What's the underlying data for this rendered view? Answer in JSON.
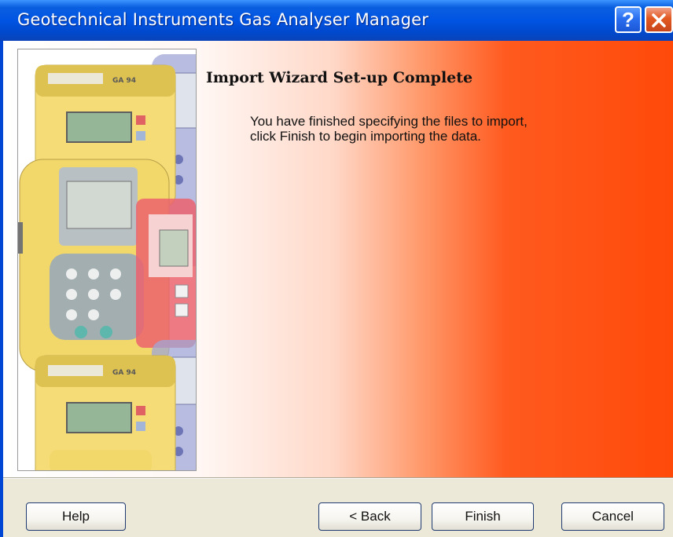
{
  "window": {
    "title": "Geotechnical Instruments Gas Analyser Manager"
  },
  "titlebar_buttons": {
    "help_glyph": "?",
    "close_icon": "close-icon"
  },
  "side_image": {
    "device_model_label": "GA 94",
    "brand_label": "Geotechnical Instruments"
  },
  "wizard": {
    "heading": "Import Wizard Set-up Complete",
    "message_line1": "You have finished specifying the files to import,",
    "message_line2": "click Finish to begin importing the data."
  },
  "buttons": {
    "help": "Help",
    "back": "< Back",
    "finish": "Finish",
    "cancel": "Cancel"
  },
  "colors": {
    "titlebar": "#0054e3",
    "gradient_end": "#ff4a0a",
    "device_yellow": "#f2d045",
    "device_blue": "#7d86c4",
    "device_red": "#e8414e"
  }
}
